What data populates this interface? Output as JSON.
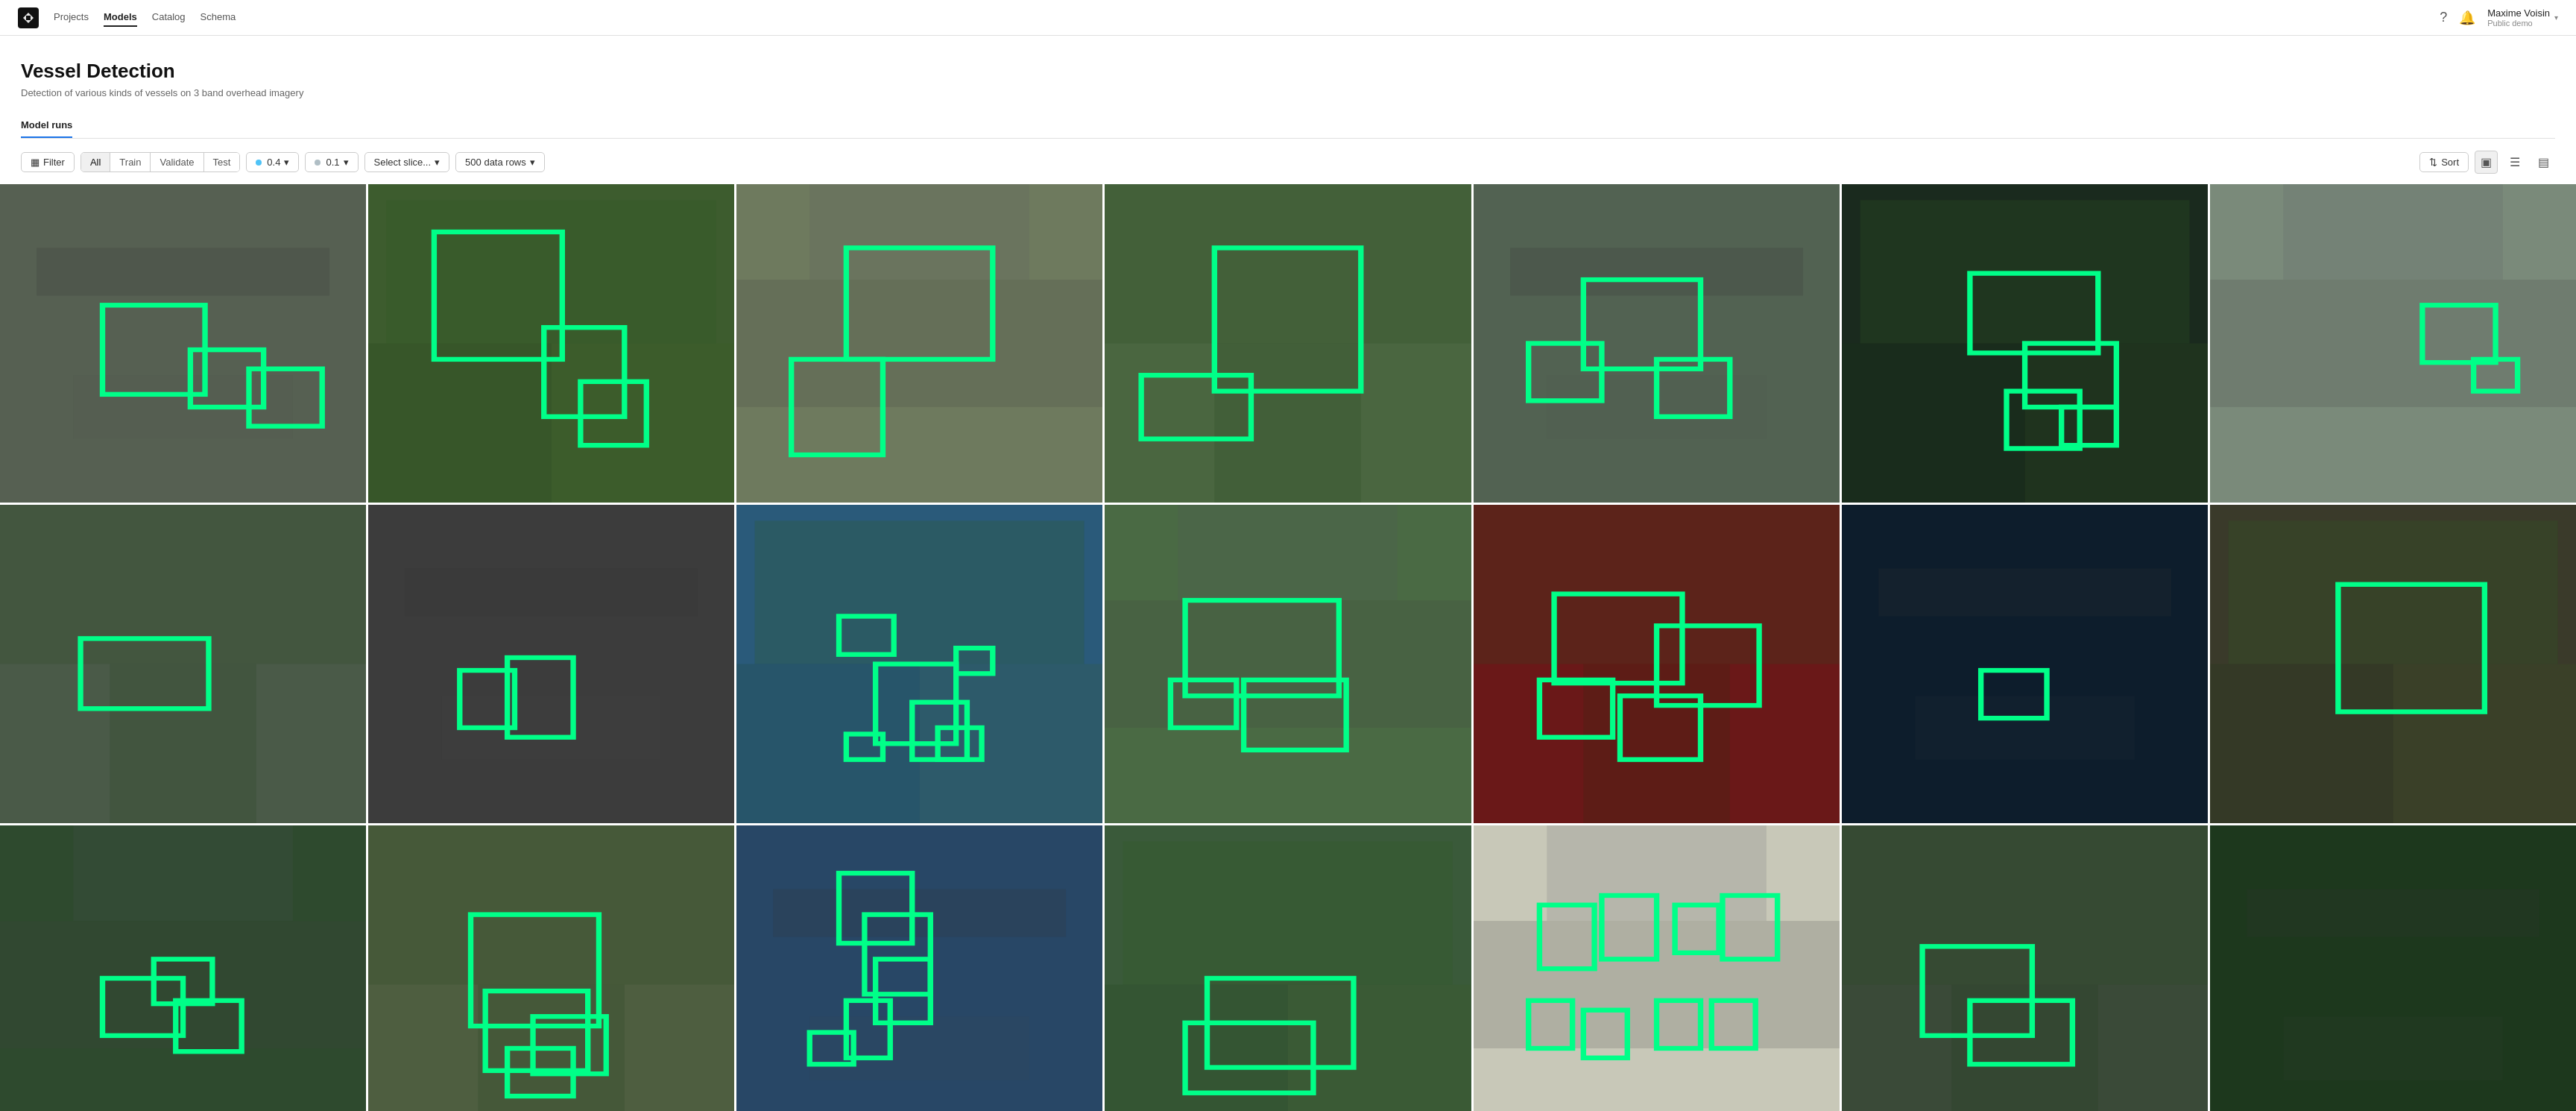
{
  "nav": {
    "links": [
      {
        "label": "Projects",
        "active": false
      },
      {
        "label": "Models",
        "active": true
      },
      {
        "label": "Catalog",
        "active": false
      },
      {
        "label": "Schema",
        "active": false
      }
    ],
    "user": {
      "name": "Maxime Voisin",
      "role": "Public demo"
    }
  },
  "page": {
    "title": "Vessel Detection",
    "description": "Detection of various kinds of vessels on 3 band overhead imagery"
  },
  "tabs": [
    {
      "label": "Model runs",
      "active": true
    }
  ],
  "toolbar": {
    "filter_label": "Filter",
    "segments": [
      {
        "label": "All",
        "active": true
      },
      {
        "label": "Train",
        "active": false
      },
      {
        "label": "Validate",
        "active": false
      },
      {
        "label": "Test",
        "active": false
      }
    ],
    "filter1": {
      "value": "0.4",
      "color": "#4fc3f7"
    },
    "filter2": {
      "value": "0.1",
      "color": "#b0bec5"
    },
    "slice_placeholder": "Select slice...",
    "data_rows": "500 data rows",
    "sort_label": "Sort"
  },
  "grid": {
    "rows": 3,
    "cols": 7,
    "cells": [
      {
        "bg": "#6b7c6b",
        "type": "aerial-runway"
      },
      {
        "bg": "#4a6b3a",
        "type": "aerial-fields"
      },
      {
        "bg": "#7a8a6a",
        "type": "aerial-parking"
      },
      {
        "bg": "#5a7a5a",
        "type": "aerial-park"
      },
      {
        "bg": "#6a7a6a",
        "type": "aerial-complex"
      },
      {
        "bg": "#2a3a2a",
        "type": "aerial-dark"
      },
      {
        "bg": "#8a9a8a",
        "type": "aerial-residential"
      },
      {
        "bg": "#5a6a5a",
        "type": "aerial-urban"
      },
      {
        "bg": "#4a4a4a",
        "type": "aerial-road"
      },
      {
        "bg": "#3a6a8a",
        "type": "aerial-harbor"
      },
      {
        "bg": "#5a7a5a",
        "type": "aerial-stadium"
      },
      {
        "bg": "#7a2a2a",
        "type": "aerial-infrared"
      },
      {
        "bg": "#1a2a3a",
        "type": "aerial-water"
      },
      {
        "bg": "#4a4a3a",
        "type": "aerial-dark2"
      },
      {
        "bg": "#3a5a3a",
        "type": "aerial-trees"
      },
      {
        "bg": "#5a6a4a",
        "type": "aerial-suburb"
      },
      {
        "bg": "#3a3a6a",
        "type": "aerial-water2"
      },
      {
        "bg": "#4a6a4a",
        "type": "aerial-field2"
      },
      {
        "bg": "#5a5a3a",
        "type": "aerial-planes"
      },
      {
        "bg": "#3a4a3a",
        "type": "aerial-urban2"
      },
      {
        "bg": "#2a4a2a",
        "type": "aerial-forest"
      }
    ]
  }
}
